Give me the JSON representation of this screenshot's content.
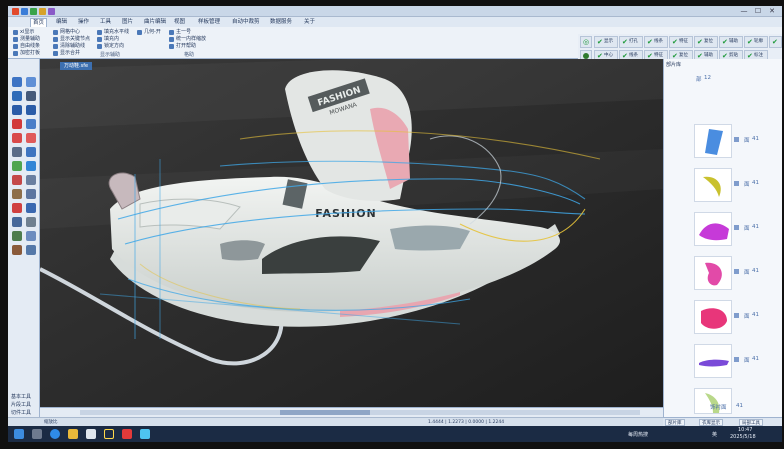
{
  "titlebar": {
    "window_controls": [
      "—",
      "☐",
      "✕"
    ]
  },
  "tabs": [
    {
      "label": "首页",
      "active": true
    },
    {
      "label": "编辑",
      "active": false
    },
    {
      "label": "操作",
      "active": false
    },
    {
      "label": "工具",
      "active": false
    },
    {
      "label": "图片",
      "active": false
    },
    {
      "label": "曲片编辑",
      "active": false
    },
    {
      "label": "视图",
      "active": false
    },
    {
      "label": "样板管理",
      "active": false
    },
    {
      "label": "自动中裁剪",
      "active": false
    },
    {
      "label": "数据服务",
      "active": false
    },
    {
      "label": "关于",
      "active": false
    }
  ],
  "ribbon": {
    "col1": [
      "xi显示",
      "测量辅助",
      "自由线条",
      "加密打板"
    ],
    "col2": [
      "网格中心",
      "显示关键节点",
      "清除辅助线",
      "显示合并"
    ],
    "col3": [
      "填充水平线",
      "填充内",
      "锁定方向"
    ],
    "col4": [
      "几何-开",
      "主一号",
      "统一内样缩放",
      "打开帮助"
    ],
    "group_labels": [
      "显示辅助",
      "格助"
    ]
  },
  "checkgrid": {
    "row1": [
      "显示",
      "打孔",
      "线条",
      "特征",
      "复位",
      "辅助",
      "轮廓",
      "缩放"
    ],
    "row2": [
      "中心",
      "线条",
      "特征",
      "复位",
      "辅助",
      "剪贴",
      "标注",
      "切割"
    ]
  },
  "lefttool": {
    "bottom_labels": [
      "基本工具",
      "片段工具",
      "切件工具"
    ]
  },
  "canvas": {
    "tab_label": "万动鞋.sfe",
    "shoe_brand_text": "FASHION",
    "tongue_label_text": "FASHION",
    "tongue_sub_text": "MOWANA"
  },
  "rightpanel": {
    "title": "部片库",
    "item0_label": "部",
    "item0_num": "12",
    "items": [
      {
        "label": "面",
        "num": "41"
      },
      {
        "label": "面",
        "num": "41"
      },
      {
        "label": "面",
        "num": "41"
      },
      {
        "label": "面",
        "num": "41"
      },
      {
        "label": "面",
        "num": "41"
      },
      {
        "label": "面",
        "num": "41"
      }
    ],
    "last_label": "饰衬面",
    "last_num": "41",
    "tabs": [
      "部片库",
      "衣库显示",
      "局部工具"
    ]
  },
  "statusbar": {
    "left": "缩放比",
    "middle": "1.4444 | 1.2273 | 0.0000 | 1.2244"
  },
  "taskbar": {
    "time": "10:47",
    "date": "2025/5/18",
    "ime": "每周热搜",
    "lang": "英"
  },
  "colors": {
    "ribbon_blue": "#3c6fb0",
    "canvas_bg": "#2b2b2b",
    "check_green": "#1e9a3a"
  }
}
